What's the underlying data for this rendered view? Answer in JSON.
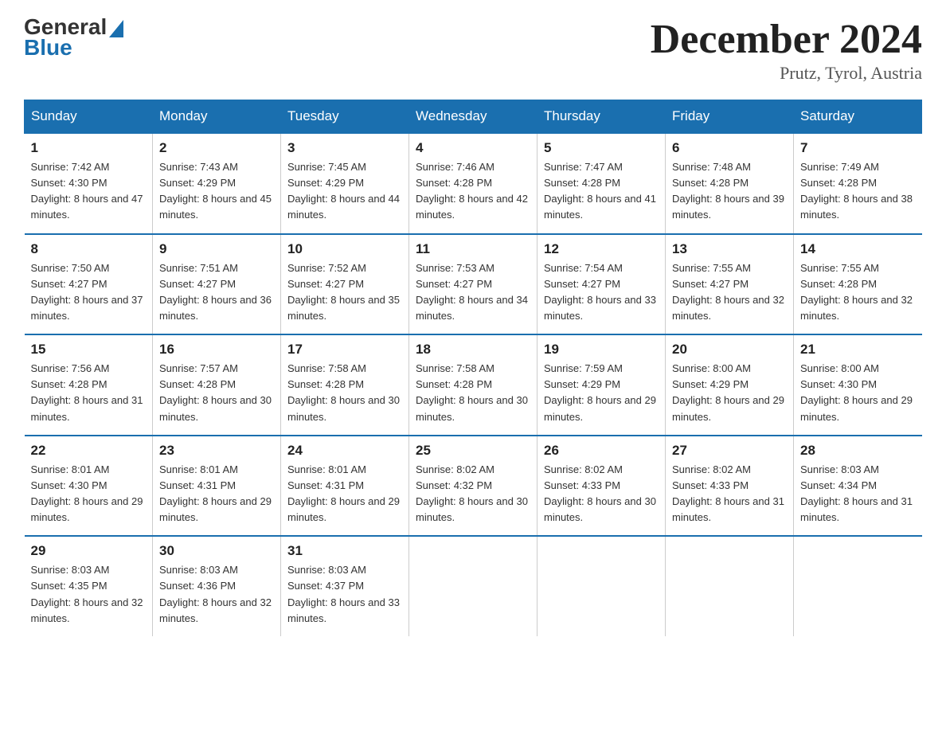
{
  "logo": {
    "general": "General",
    "blue": "Blue"
  },
  "title": "December 2024",
  "subtitle": "Prutz, Tyrol, Austria",
  "days_of_week": [
    "Sunday",
    "Monday",
    "Tuesday",
    "Wednesday",
    "Thursday",
    "Friday",
    "Saturday"
  ],
  "weeks": [
    [
      {
        "day": "1",
        "sunrise": "7:42 AM",
        "sunset": "4:30 PM",
        "daylight": "8 hours and 47 minutes."
      },
      {
        "day": "2",
        "sunrise": "7:43 AM",
        "sunset": "4:29 PM",
        "daylight": "8 hours and 45 minutes."
      },
      {
        "day": "3",
        "sunrise": "7:45 AM",
        "sunset": "4:29 PM",
        "daylight": "8 hours and 44 minutes."
      },
      {
        "day": "4",
        "sunrise": "7:46 AM",
        "sunset": "4:28 PM",
        "daylight": "8 hours and 42 minutes."
      },
      {
        "day": "5",
        "sunrise": "7:47 AM",
        "sunset": "4:28 PM",
        "daylight": "8 hours and 41 minutes."
      },
      {
        "day": "6",
        "sunrise": "7:48 AM",
        "sunset": "4:28 PM",
        "daylight": "8 hours and 39 minutes."
      },
      {
        "day": "7",
        "sunrise": "7:49 AM",
        "sunset": "4:28 PM",
        "daylight": "8 hours and 38 minutes."
      }
    ],
    [
      {
        "day": "8",
        "sunrise": "7:50 AM",
        "sunset": "4:27 PM",
        "daylight": "8 hours and 37 minutes."
      },
      {
        "day": "9",
        "sunrise": "7:51 AM",
        "sunset": "4:27 PM",
        "daylight": "8 hours and 36 minutes."
      },
      {
        "day": "10",
        "sunrise": "7:52 AM",
        "sunset": "4:27 PM",
        "daylight": "8 hours and 35 minutes."
      },
      {
        "day": "11",
        "sunrise": "7:53 AM",
        "sunset": "4:27 PM",
        "daylight": "8 hours and 34 minutes."
      },
      {
        "day": "12",
        "sunrise": "7:54 AM",
        "sunset": "4:27 PM",
        "daylight": "8 hours and 33 minutes."
      },
      {
        "day": "13",
        "sunrise": "7:55 AM",
        "sunset": "4:27 PM",
        "daylight": "8 hours and 32 minutes."
      },
      {
        "day": "14",
        "sunrise": "7:55 AM",
        "sunset": "4:28 PM",
        "daylight": "8 hours and 32 minutes."
      }
    ],
    [
      {
        "day": "15",
        "sunrise": "7:56 AM",
        "sunset": "4:28 PM",
        "daylight": "8 hours and 31 minutes."
      },
      {
        "day": "16",
        "sunrise": "7:57 AM",
        "sunset": "4:28 PM",
        "daylight": "8 hours and 30 minutes."
      },
      {
        "day": "17",
        "sunrise": "7:58 AM",
        "sunset": "4:28 PM",
        "daylight": "8 hours and 30 minutes."
      },
      {
        "day": "18",
        "sunrise": "7:58 AM",
        "sunset": "4:28 PM",
        "daylight": "8 hours and 30 minutes."
      },
      {
        "day": "19",
        "sunrise": "7:59 AM",
        "sunset": "4:29 PM",
        "daylight": "8 hours and 29 minutes."
      },
      {
        "day": "20",
        "sunrise": "8:00 AM",
        "sunset": "4:29 PM",
        "daylight": "8 hours and 29 minutes."
      },
      {
        "day": "21",
        "sunrise": "8:00 AM",
        "sunset": "4:30 PM",
        "daylight": "8 hours and 29 minutes."
      }
    ],
    [
      {
        "day": "22",
        "sunrise": "8:01 AM",
        "sunset": "4:30 PM",
        "daylight": "8 hours and 29 minutes."
      },
      {
        "day": "23",
        "sunrise": "8:01 AM",
        "sunset": "4:31 PM",
        "daylight": "8 hours and 29 minutes."
      },
      {
        "day": "24",
        "sunrise": "8:01 AM",
        "sunset": "4:31 PM",
        "daylight": "8 hours and 29 minutes."
      },
      {
        "day": "25",
        "sunrise": "8:02 AM",
        "sunset": "4:32 PM",
        "daylight": "8 hours and 30 minutes."
      },
      {
        "day": "26",
        "sunrise": "8:02 AM",
        "sunset": "4:33 PM",
        "daylight": "8 hours and 30 minutes."
      },
      {
        "day": "27",
        "sunrise": "8:02 AM",
        "sunset": "4:33 PM",
        "daylight": "8 hours and 31 minutes."
      },
      {
        "day": "28",
        "sunrise": "8:03 AM",
        "sunset": "4:34 PM",
        "daylight": "8 hours and 31 minutes."
      }
    ],
    [
      {
        "day": "29",
        "sunrise": "8:03 AM",
        "sunset": "4:35 PM",
        "daylight": "8 hours and 32 minutes."
      },
      {
        "day": "30",
        "sunrise": "8:03 AM",
        "sunset": "4:36 PM",
        "daylight": "8 hours and 32 minutes."
      },
      {
        "day": "31",
        "sunrise": "8:03 AM",
        "sunset": "4:37 PM",
        "daylight": "8 hours and 33 minutes."
      },
      null,
      null,
      null,
      null
    ]
  ]
}
